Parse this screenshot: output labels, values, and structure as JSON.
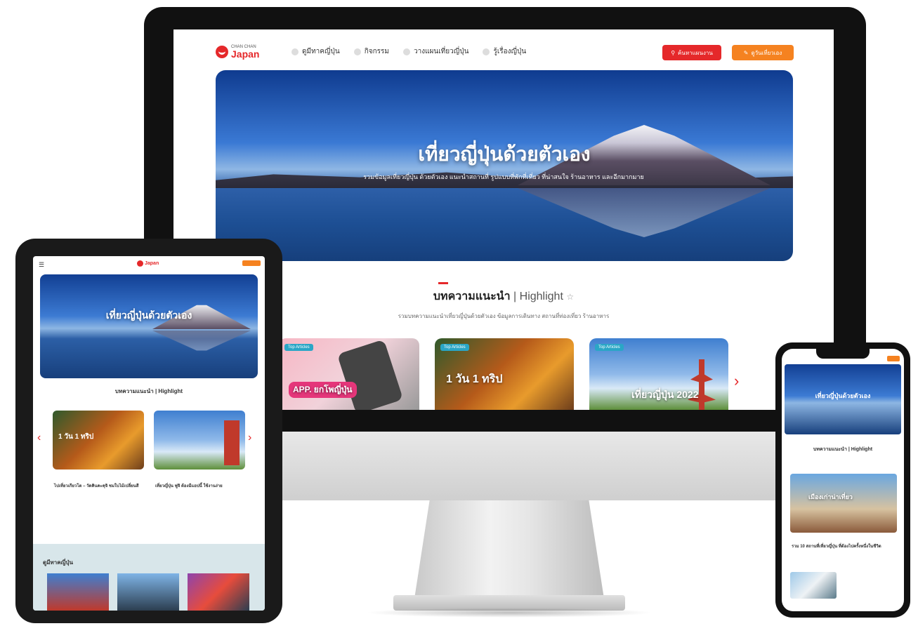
{
  "desktop": {
    "logo": {
      "small": "CHAN CHAN",
      "big": "Japan"
    },
    "nav": [
      "ดูมีทาคญี่ปุ่น",
      "กิจกรรม",
      "วางแผนเที่ยวญี่ปุ่น",
      "รู้เรื่องญี่ปุ่น"
    ],
    "search_button": "ค้นหาแผนงาน",
    "planner_button": "ดูวันเที่ยวเอง",
    "hero": {
      "title": "เที่ยวญี่ปุ่นด้วยตัวเอง",
      "subtitle": "รวมข้อมูลเที่ยวญี่ปุ่น ด้วยตัวเอง แนะนำสถานที่ รูปแบบที่พักที่เที่ยว ที่น่าสนใจ ร้านอาหาร และอีกมากมาย"
    },
    "section": {
      "title_th": "บทความแนะนำ",
      "title_en": "| Highlight",
      "subtitle": "รวมบทความแนะนำเที่ยวญี่ปุ่นด้วยตัวเอง ข้อมูลการเดินทาง สถานที่ท่องเที่ยว ร้านอาหาร"
    },
    "cards": [
      {
        "tag": "Top Articles",
        "text": "APP. ยกโพญี่ปุ่น"
      },
      {
        "tag": "Top Articles",
        "text": "1 วัน 1 ทริป"
      },
      {
        "tag": "Top Articles",
        "text": "เที่ยวญี่ปุ่น 2022"
      }
    ]
  },
  "tablet": {
    "hero_title": "เที่ยวญี่ปุ่นด้วยตัวเอง",
    "section_title": "บทความแนะนำ | Highlight",
    "articles": [
      {
        "text": "1 วัน 1 ทริป",
        "title": "ไปเที่ยวเกียวโต – วัดคินคะคุจิ ชมใบไม้เปลี่ยนสี"
      },
      {
        "text": "",
        "title": "เที่ยวญี่ปุ่น ฟูจิ ต้องมีแอปนี้ ใช้งานง่าย"
      }
    ],
    "bottom_title": "ดูมีทาคญี่ปุ่น"
  },
  "phone": {
    "hero_title": "เที่ยวญี่ปุ่นด้วยตัวเอง",
    "section_title": "บทความแนะนำ | Highlight",
    "card_text": "เมืองเก่าน่าเที่ยว",
    "headline": "รวม 10 สถานที่เที่ยวญี่ปุ่น ที่ต้องไปครั้งหนึ่งในชีวิต"
  },
  "colors": {
    "brand_red": "#e5282a",
    "accent_orange": "#f58220",
    "tag_teal": "#2aa6c6"
  }
}
